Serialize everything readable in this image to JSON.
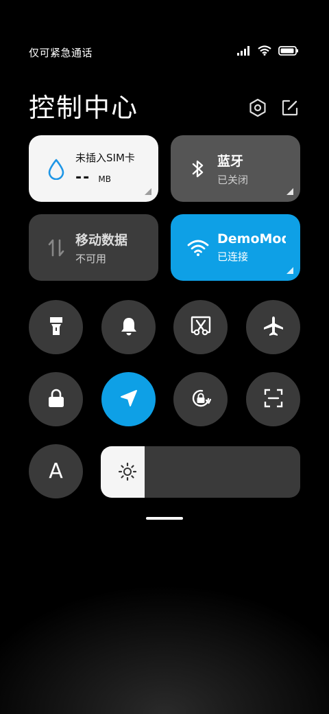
{
  "status_bar": {
    "carrier_text": "仅可紧急通话",
    "battery_level": 0.95,
    "icons": [
      "signal-icon",
      "wifi-icon",
      "battery-icon"
    ]
  },
  "header": {
    "title": "控制中心",
    "settings_icon": "settings-hexagon-icon",
    "edit_icon": "edit-icon"
  },
  "tiles": {
    "data": {
      "title": "未插入SIM卡",
      "value": "--",
      "unit": "MB",
      "icon": "water-drop-icon"
    },
    "bluetooth": {
      "title": "蓝牙",
      "status": "已关闭",
      "icon": "bluetooth-icon"
    },
    "mobile_data": {
      "title": "移动数据",
      "status": "不可用",
      "icon": "data-arrows-icon"
    },
    "wifi": {
      "title": "DemoMod",
      "status": "已连接",
      "icon": "wifi-icon"
    }
  },
  "toggles": [
    {
      "name": "flashlight",
      "icon": "flashlight-icon",
      "active": false
    },
    {
      "name": "bell",
      "icon": "bell-icon",
      "active": false
    },
    {
      "name": "screenshot",
      "icon": "screenshot-scissors-icon",
      "active": false
    },
    {
      "name": "airplane",
      "icon": "airplane-icon",
      "active": false
    },
    {
      "name": "lock",
      "icon": "lock-icon",
      "active": false
    },
    {
      "name": "location",
      "icon": "location-arrow-icon",
      "active": true
    },
    {
      "name": "rotation-lock",
      "icon": "rotation-lock-icon",
      "active": false
    },
    {
      "name": "scanner",
      "icon": "scan-icon",
      "active": false
    },
    {
      "name": "font",
      "label": "A",
      "icon": "font-icon",
      "active": false
    }
  ],
  "brightness": {
    "level": 0.22,
    "icon": "sun-icon"
  },
  "colors": {
    "accent": "#0ea0e6",
    "tile_dark": "#3c3c3c",
    "tile_gray": "#555555",
    "tile_light": "#f5f5f5"
  }
}
